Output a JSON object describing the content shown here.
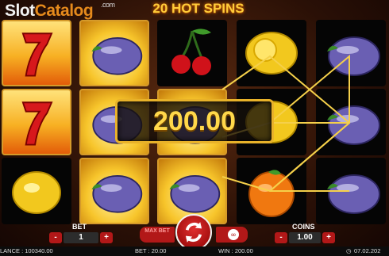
{
  "logo": {
    "text_slot": "Slot",
    "text_catalog": "Catalog",
    "text_com": ".com"
  },
  "game_title": "20 HOT SPINS",
  "reels": [
    [
      "seven",
      "seven",
      "lemon"
    ],
    [
      "plum",
      "plum",
      "plum"
    ],
    [
      "cherry",
      "plum",
      "plum"
    ],
    [
      "lemon",
      "lemon",
      "orange"
    ],
    [
      "plum",
      "plum",
      "plum"
    ]
  ],
  "win_amount": "200.00",
  "controls": {
    "bet_label": "BET",
    "bet_value": "1",
    "bet_minus": "-",
    "bet_plus": "+",
    "maxbet_label": "MAX BET",
    "coins_label": "COINS",
    "coins_value": "1.00",
    "coins_minus": "-",
    "coins_plus": "+"
  },
  "infobar": {
    "balance": "LANCE : 100340.00",
    "bet": "BET : 20.00",
    "win": "WIN : 200.00",
    "date": "07.02.202"
  },
  "colors": {
    "accent_red": "#b21818",
    "gold": "#e8b22a",
    "win_text": "#ffd84a"
  }
}
